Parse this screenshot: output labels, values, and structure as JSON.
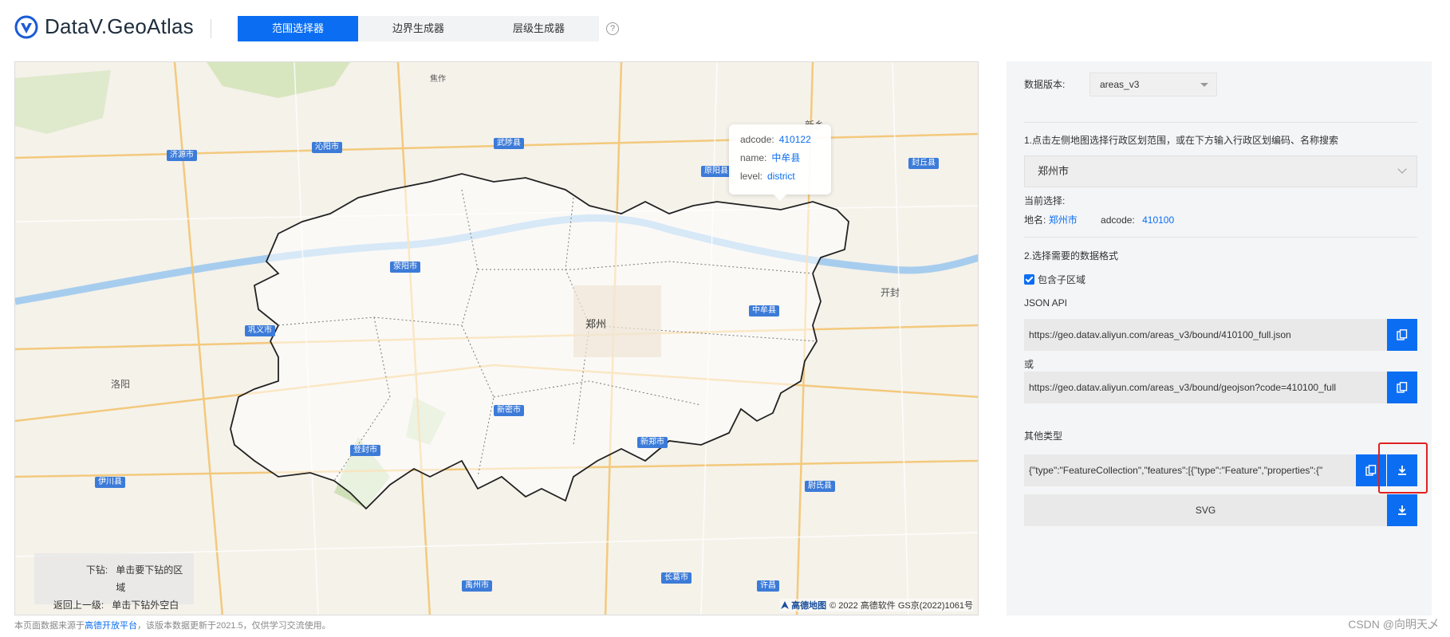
{
  "app": {
    "title": "DataV.GeoAtlas"
  },
  "tabs": [
    {
      "label": "范围选择器",
      "active": true
    },
    {
      "label": "边界生成器",
      "active": false
    },
    {
      "label": "层级生成器",
      "active": false
    }
  ],
  "help_icon": "question-circle-icon",
  "map": {
    "tooltip": {
      "adcode_label": "adcode:",
      "adcode_value": "410122",
      "name_label": "name:",
      "name_value": "中牟县",
      "level_label": "level:",
      "level_value": "district"
    },
    "hint": {
      "drill_down_label": "下钻:",
      "drill_down_text": "单击要下钻的区域",
      "go_up_label": "返回上一级:",
      "go_up_text": "单击下钻外空白区域"
    },
    "attribution": {
      "brand": "高德地图",
      "copyright": "© 2022 高德软件 GS京(2022)1061号"
    },
    "places": [
      "焦作",
      "济源市",
      "沁阳市",
      "武陟县",
      "原阳县",
      "新乡",
      "封丘县",
      "郑州",
      "巩义市",
      "荥阳市",
      "中牟县",
      "新郑市",
      "新密市",
      "登封市",
      "洛阳",
      "伊川县",
      "开封",
      "尉氏县",
      "长葛市",
      "禹州市",
      "许昌"
    ],
    "colors": {
      "boundary": "#222222",
      "highlight": "rgba(255,255,255,0.55)",
      "river": "#9ec9ee"
    }
  },
  "footer": {
    "note_prefix": "本页面数据来源于",
    "note_link": "高德开放平台",
    "note_suffix": "，该版本数据更新于2021.5，仅供学习交流使用。",
    "watermark": "CSDN @向明天乄"
  },
  "panel": {
    "version_label": "数据版本:",
    "version_value": "areas_v3",
    "step1_text": "1.点击左侧地图选择行政区划范围，或在下方输入行政区划编码、名称搜索",
    "search_value": "郑州市",
    "current_selection_label": "当前选择:",
    "place_name_label": "地名:",
    "place_name_value": "郑州市",
    "adcode_label": "adcode:",
    "adcode_value": "410100",
    "step2_text": "2.选择需要的数据格式",
    "include_subareas_label": "包含子区域",
    "include_subareas_checked": true,
    "json_api_label": "JSON API",
    "json_api_url": "https://geo.datav.aliyun.com/areas_v3/bound/410100_full.json",
    "or_label": "或",
    "geojson_url": "https://geo.datav.aliyun.com/areas_v3/bound/geojson?code=410100_full",
    "other_types_label": "其他类型",
    "geojson_preview": "{\"type\":\"FeatureCollection\",\"features\":[{\"type\":\"Feature\",\"properties\":{\"",
    "svg_label": "SVG",
    "accent_color": "#0b6ef2"
  }
}
